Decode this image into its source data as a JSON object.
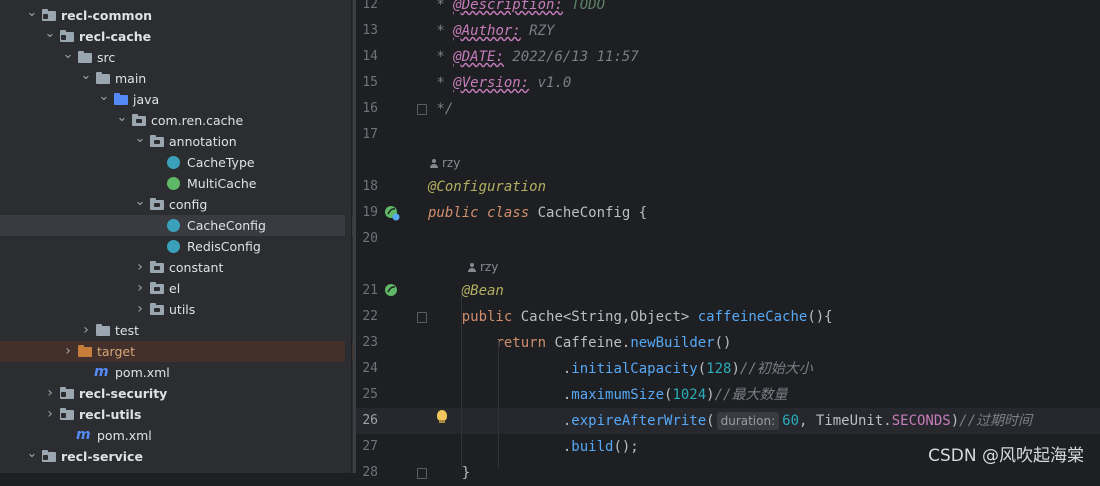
{
  "tree": [
    {
      "label": "recl-common",
      "depth": 0,
      "chev": "v",
      "icon": "module-folder",
      "bold": true
    },
    {
      "label": "recl-cache",
      "depth": 1,
      "chev": "v",
      "icon": "module-folder",
      "bold": true
    },
    {
      "label": "src",
      "depth": 2,
      "chev": "v",
      "icon": "folder"
    },
    {
      "label": "main",
      "depth": 3,
      "chev": "v",
      "icon": "folder"
    },
    {
      "label": "java",
      "depth": 4,
      "chev": "v",
      "icon": "source-folder"
    },
    {
      "label": "com.ren.cache",
      "depth": 5,
      "chev": "v",
      "icon": "package"
    },
    {
      "label": "annotation",
      "depth": 6,
      "chev": "v",
      "icon": "package"
    },
    {
      "label": "CacheType",
      "depth": 7,
      "chev": "",
      "icon": "enum"
    },
    {
      "label": "MultiCache",
      "depth": 7,
      "chev": "",
      "icon": "annotation"
    },
    {
      "label": "config",
      "depth": 6,
      "chev": "v",
      "icon": "package"
    },
    {
      "label": "CacheConfig",
      "depth": 7,
      "chev": "",
      "icon": "class",
      "selected": true
    },
    {
      "label": "RedisConfig",
      "depth": 7,
      "chev": "",
      "icon": "class"
    },
    {
      "label": "constant",
      "depth": 6,
      "chev": ">",
      "icon": "package"
    },
    {
      "label": "el",
      "depth": 6,
      "chev": ">",
      "icon": "package"
    },
    {
      "label": "utils",
      "depth": 6,
      "chev": ">",
      "icon": "package"
    },
    {
      "label": "test",
      "depth": 3,
      "chev": ">",
      "icon": "folder"
    },
    {
      "label": "target",
      "depth": 2,
      "chev": ">",
      "icon": "excluded-folder",
      "excluded": true
    },
    {
      "label": "pom.xml",
      "depth": 3,
      "chev": "",
      "icon": "maven"
    },
    {
      "label": "recl-security",
      "depth": 1,
      "chev": ">",
      "icon": "module-folder",
      "bold": true
    },
    {
      "label": "recl-utils",
      "depth": 1,
      "chev": ">",
      "icon": "module-folder",
      "bold": true
    },
    {
      "label": "pom.xml",
      "depth": 2,
      "chev": "",
      "icon": "maven"
    },
    {
      "label": "recl-service",
      "depth": 0,
      "chev": "v",
      "icon": "module-folder",
      "bold": true
    }
  ],
  "editor": {
    "current_line": "26",
    "lines": [
      {
        "num": "12",
        "tokens": [
          {
            "t": " * ",
            "c": "cm"
          },
          {
            "t": "@Description:",
            "c": "doctag"
          },
          {
            "t": " TODO",
            "c": "docval"
          }
        ]
      },
      {
        "num": "13",
        "tokens": [
          {
            "t": " * ",
            "c": "cm"
          },
          {
            "t": "@Author:",
            "c": "doctag"
          },
          {
            "t": " RZY",
            "c": "cm"
          }
        ]
      },
      {
        "num": "14",
        "tokens": [
          {
            "t": " * ",
            "c": "cm"
          },
          {
            "t": "@DATE:",
            "c": "doctag"
          },
          {
            "t": " 2022/6/13 11:57",
            "c": "cm"
          }
        ]
      },
      {
        "num": "15",
        "tokens": [
          {
            "t": " * ",
            "c": "cm"
          },
          {
            "t": "@Version:",
            "c": "doctag"
          },
          {
            "t": " v1.0",
            "c": "cm"
          }
        ]
      },
      {
        "num": "16",
        "tokens": [
          {
            "t": " */",
            "c": "cm"
          }
        ]
      },
      {
        "num": "17",
        "tokens": []
      },
      {
        "num": "18",
        "tokens": [
          {
            "t": "@Configuration",
            "c": "an"
          }
        ]
      },
      {
        "num": "19",
        "tokens": [
          {
            "t": "public class ",
            "c": "k"
          },
          {
            "t": "CacheConfig {",
            "c": ""
          }
        ]
      },
      {
        "num": "20",
        "tokens": []
      },
      {
        "num": "21",
        "tokens": [
          {
            "t": "    ",
            "c": ""
          },
          {
            "t": "@Bean",
            "c": "an"
          }
        ]
      },
      {
        "num": "22",
        "tokens": [
          {
            "t": "    ",
            "c": ""
          },
          {
            "t": "public ",
            "c": "kw"
          },
          {
            "t": "Cache<String,Object> ",
            "c": ""
          },
          {
            "t": "caffeineCache",
            "c": "fn"
          },
          {
            "t": "(){",
            "c": ""
          }
        ]
      },
      {
        "num": "23",
        "tokens": [
          {
            "t": "        ",
            "c": ""
          },
          {
            "t": "return ",
            "c": "kw"
          },
          {
            "t": "Caffeine.",
            "c": ""
          },
          {
            "t": "newBuilder",
            "c": "mc"
          },
          {
            "t": "()",
            "c": ""
          }
        ]
      },
      {
        "num": "24",
        "tokens": [
          {
            "t": "                .",
            "c": ""
          },
          {
            "t": "initialCapacity",
            "c": "mc"
          },
          {
            "t": "(",
            "c": ""
          },
          {
            "t": "128",
            "c": "num"
          },
          {
            "t": ")",
            "c": ""
          },
          {
            "t": "//初始大小",
            "c": "cm"
          }
        ]
      },
      {
        "num": "25",
        "tokens": [
          {
            "t": "                .",
            "c": ""
          },
          {
            "t": "maximumSize",
            "c": "mc"
          },
          {
            "t": "(",
            "c": ""
          },
          {
            "t": "1024",
            "c": "num"
          },
          {
            "t": ")",
            "c": ""
          },
          {
            "t": "//最大数量",
            "c": "cm"
          }
        ]
      },
      {
        "num": "26",
        "tokens": [
          {
            "t": "                .",
            "c": ""
          },
          {
            "t": "expireAfterWrite",
            "c": "mc"
          },
          {
            "t": "(",
            "c": ""
          },
          {
            "t": "duration:",
            "c": "hint"
          },
          {
            "t": "60",
            "c": "num"
          },
          {
            "t": ", TimeUnit.",
            "c": ""
          },
          {
            "t": "SECONDS",
            "c": "enumc"
          },
          {
            "t": ")",
            "c": ""
          },
          {
            "t": "//过期时间",
            "c": "cm"
          }
        ]
      },
      {
        "num": "27",
        "tokens": [
          {
            "t": "                .",
            "c": ""
          },
          {
            "t": "build",
            "c": "mc"
          },
          {
            "t": "();",
            "c": ""
          }
        ]
      },
      {
        "num": "28",
        "tokens": [
          {
            "t": "    }",
            "c": ""
          }
        ]
      }
    ],
    "authors": [
      {
        "label": "rzy",
        "before_line": "18"
      },
      {
        "label": "rzy",
        "before_line": "21"
      }
    ]
  },
  "watermark": "CSDN @风吹起海棠"
}
